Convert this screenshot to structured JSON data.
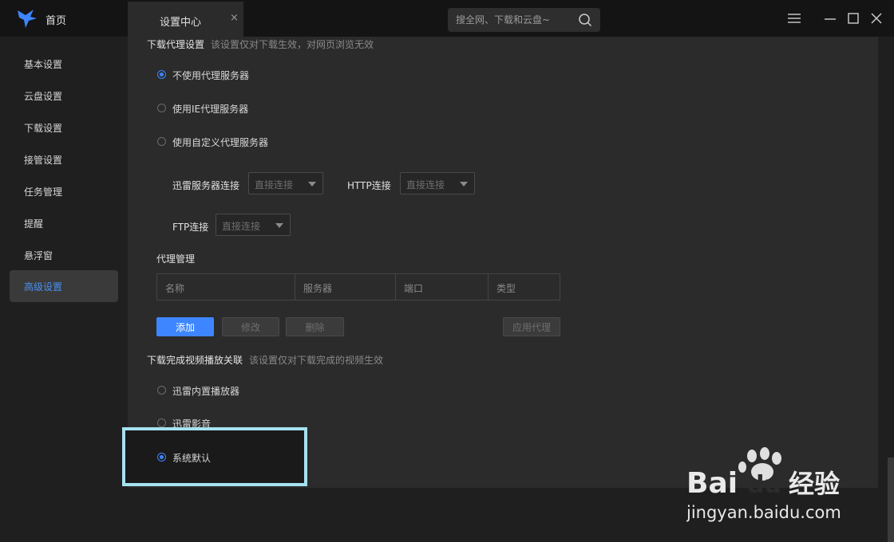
{
  "titlebar": {
    "home_label": "首页",
    "tab_label": "设置中心",
    "tab_close": "×",
    "search_placeholder": "搜全网、下载和云盘~"
  },
  "sidebar": {
    "items": [
      {
        "label": "基本设置"
      },
      {
        "label": "云盘设置"
      },
      {
        "label": "下载设置"
      },
      {
        "label": "接管设置"
      },
      {
        "label": "任务管理"
      },
      {
        "label": "提醒"
      },
      {
        "label": "悬浮窗"
      },
      {
        "label": "高级设置"
      }
    ],
    "active_index": 7
  },
  "proxy": {
    "title": "下载代理设置",
    "desc": "该设置仅对下载生效，对网页浏览无效",
    "options": [
      {
        "label": "不使用代理服务器",
        "checked": true
      },
      {
        "label": "使用IE代理服务器",
        "checked": false
      },
      {
        "label": "使用自定义代理服务器",
        "checked": false
      }
    ],
    "fields": {
      "xunlei_label": "迅雷服务器连接",
      "xunlei_value": "直接连接",
      "http_label": "HTTP连接",
      "http_value": "直接连接",
      "ftp_label": "FTP连接",
      "ftp_value": "直接连接"
    },
    "manage_title": "代理管理",
    "table_headers": [
      "名称",
      "服务器",
      "端口",
      "类型"
    ],
    "buttons": {
      "add": "添加",
      "edit": "修改",
      "delete": "删除",
      "apply": "应用代理"
    }
  },
  "video": {
    "title": "下载完成视频播放关联",
    "desc": "该设置仅对下载完成的视频生效",
    "options": [
      {
        "label": "迅雷内置播放器",
        "checked": false
      },
      {
        "label": "迅雷影音",
        "checked": false
      },
      {
        "label": "系统默认",
        "checked": true
      }
    ]
  },
  "watermark": {
    "brand_left": "Bai",
    "brand_right": "du",
    "brand_cn": "经验",
    "url": "jingyan.baidu.com"
  },
  "colors": {
    "accent": "#3d86ff",
    "active_sidebar_text": "#4a90f0",
    "highlight_border": "#a6e1f0"
  }
}
